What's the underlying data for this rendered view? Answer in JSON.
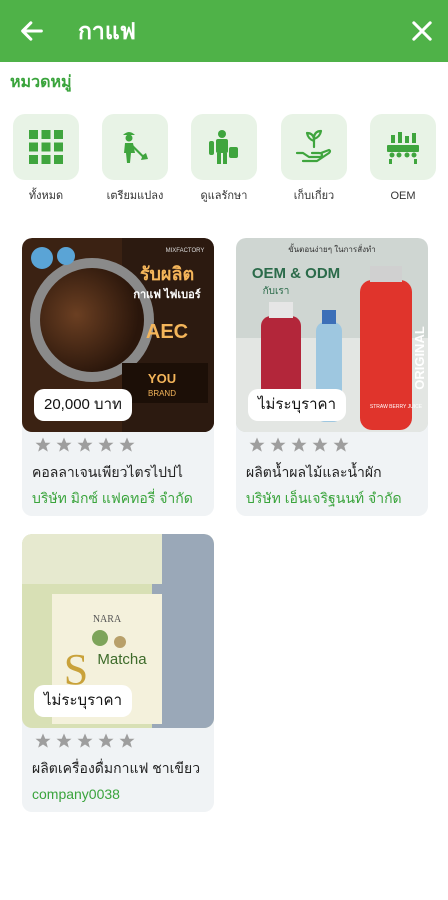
{
  "header": {
    "title": "กาแฟ",
    "back_icon": "arrow-left-icon",
    "close_icon": "close-icon"
  },
  "categories": {
    "title": "หมวดหมู่",
    "items": [
      {
        "label": "ทั้งหมด",
        "icon": "grid-icon"
      },
      {
        "label": "เตรียมแปลง",
        "icon": "farmer-icon"
      },
      {
        "label": "ดูแลรักษา",
        "icon": "sprayer-icon"
      },
      {
        "label": "เก็บเกี่ยว",
        "icon": "harvest-hand-icon"
      },
      {
        "label": "OEM",
        "icon": "factory-icon"
      }
    ]
  },
  "products": [
    {
      "price": "20,000 บาท",
      "name": "คอลลาเจนเพียวไตรไปปไ",
      "company": "บริษัท มิกซ์ แฟคทอรี่ จำกัด",
      "rating": 0,
      "image_text": {
        "headline": "รับผลิต",
        "sub1": "กาแฟ ไฟเบอร์",
        "brand": "YOU",
        "brand2": "BRAND",
        "aec": "AEC",
        "factory": "MIXFACTORY"
      }
    },
    {
      "price": "ไม่ระบุราคา",
      "name": "ผลิตน้ำผลไม้และน้ำผัก",
      "company": "บริษัท เอ็นเจริฐนนท์ จำกัด",
      "rating": 0,
      "image_text": {
        "top": "ขั้นตอนง่ายๆ ในการสั่งทำ",
        "oem": "OEM & ODM",
        "sub": "กับเรา",
        "bottle": "ORIGINAL",
        "bottle2": "STRAW BERRY JUICE"
      }
    },
    {
      "price": "ไม่ระบุราคา",
      "name": "ผลิตเครื่องดื่มกาแฟ ชาเขียว",
      "company": "company0038",
      "rating": 0,
      "image_text": {
        "brand": "NARA",
        "product": "Matcha",
        "big": "S"
      }
    }
  ],
  "colors": {
    "primary": "#4fb248",
    "accent": "#3aa43c",
    "icon_bg": "#e8f3e6",
    "star": "#9e9e9e"
  }
}
